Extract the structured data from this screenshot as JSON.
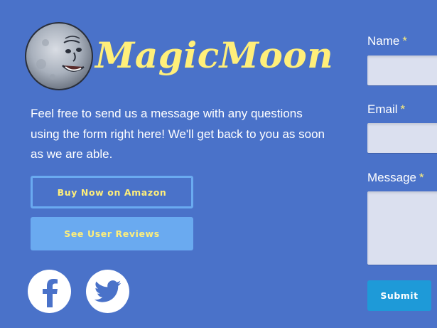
{
  "brand": {
    "name": "MagicMoon",
    "logo_icon": "moon-face-icon",
    "color": "#ffef7a"
  },
  "intro": {
    "text": "Feel free to send us a message with any questions using the form right here! We'll get back to you as soon as we are able."
  },
  "buttons": {
    "amazon_label": "Buy Now on Amazon",
    "reviews_label": "See User Reviews"
  },
  "social": {
    "facebook_icon": "facebook-icon",
    "twitter_icon": "twitter-icon"
  },
  "form": {
    "name_label": "Name",
    "email_label": "Email",
    "message_label": "Message",
    "required_marker": "*",
    "name_value": "",
    "email_value": "",
    "message_value": "",
    "submit_label": "Submit"
  },
  "colors": {
    "background": "#4a72c9",
    "accent_yellow": "#ffef7a",
    "light_blue": "#6aaaf0",
    "submit_blue": "#1e9ad8",
    "field_bg": "#dbe0ef"
  }
}
